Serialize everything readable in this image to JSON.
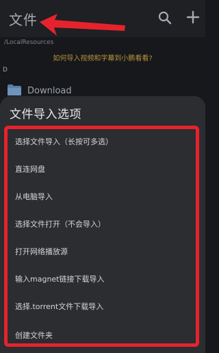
{
  "appbar": {
    "title": "文件",
    "icons": {
      "search": "search-icon",
      "add": "plus-icon"
    },
    "annotation_arrow_color": "#e6232d"
  },
  "path": "/LocalResources",
  "tip": "如何导入视频和字幕到小鹏看看?",
  "section_letter": "D",
  "folder": {
    "name": "Download",
    "icon": "folder-icon"
  },
  "sheet": {
    "title": "文件导入选项",
    "highlight_color": "#e6232d",
    "options": [
      "选择文件导入（长按可多选）",
      "直连网盘",
      "从电脑导入",
      "选择文件打开（不会导入）",
      "打开网络播放源",
      "输入magnet链接下载导入",
      "选择.torrent文件下载导入",
      "创建文件夹"
    ]
  }
}
